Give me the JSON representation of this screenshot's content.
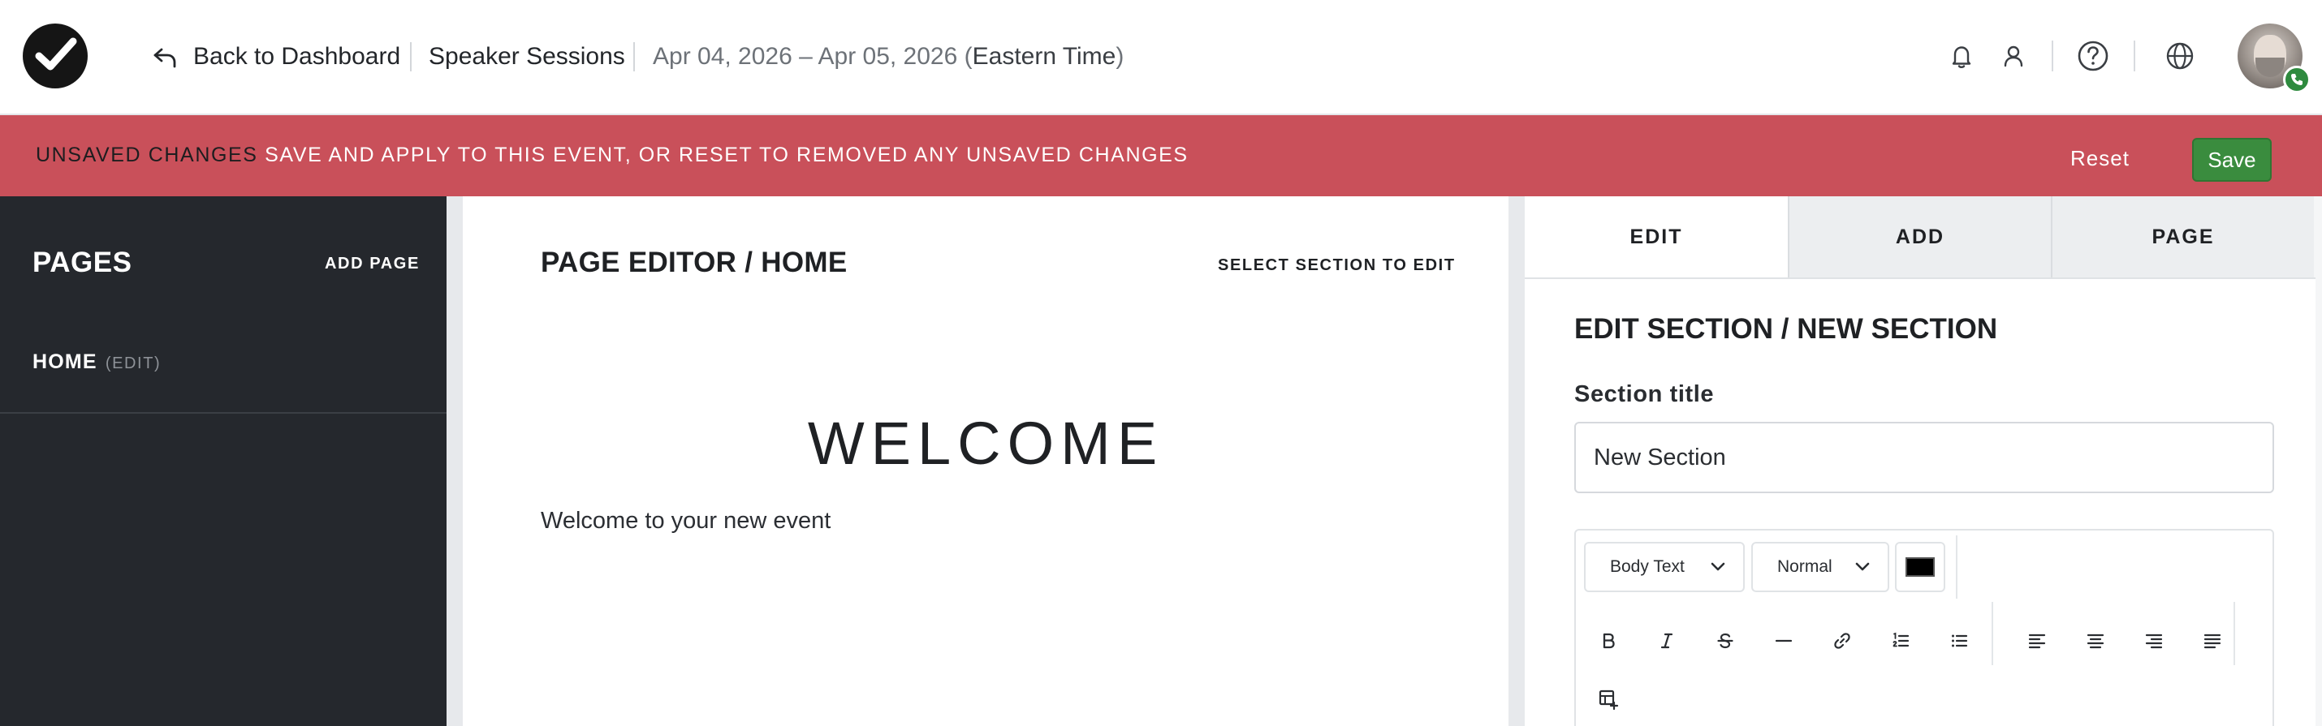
{
  "header": {
    "back_label": "Back to Dashboard",
    "event_name": "Speaker Sessions",
    "dates": "Apr 04, 2026 – Apr 05, 2026 (",
    "timezone": "Eastern Time",
    "dates_close": ")",
    "icons": [
      "bell-icon",
      "user-icon",
      "help-icon",
      "globe-icon"
    ]
  },
  "banner": {
    "strong": "UNSAVED CHANGES",
    "message": " SAVE AND APPLY TO THIS EVENT, OR RESET TO REMOVED ANY UNSAVED CHANGES",
    "reset_label": "Reset",
    "save_label": "Save",
    "color": "#c9505a"
  },
  "sidebar": {
    "title": "PAGES",
    "add_label": "ADD PAGE",
    "items": [
      {
        "label": "HOME",
        "edit_label": "(EDIT)"
      }
    ]
  },
  "editor": {
    "title": "PAGE EDITOR / HOME",
    "hint": "SELECT SECTION TO EDIT",
    "section_heading": "WELCOME",
    "section_body": "Welcome to your new event"
  },
  "panel": {
    "tabs": [
      {
        "label": "EDIT",
        "active": true
      },
      {
        "label": "ADD",
        "active": false
      },
      {
        "label": "PAGE",
        "active": false
      }
    ],
    "title": "EDIT SECTION / NEW SECTION",
    "field_label": "Section title",
    "field_value": "New Section",
    "toolbar": {
      "block_type": "Body Text",
      "font_size": "Normal",
      "text_color": "#000000",
      "buttons": [
        "bold-icon",
        "italic-icon",
        "strikethrough-icon",
        "horizontal-rule-icon",
        "link-icon",
        "ordered-list-icon",
        "bullet-list-icon",
        "align-left-icon",
        "align-center-icon",
        "align-right-icon",
        "align-justify-icon",
        "insert-table-icon"
      ]
    }
  }
}
